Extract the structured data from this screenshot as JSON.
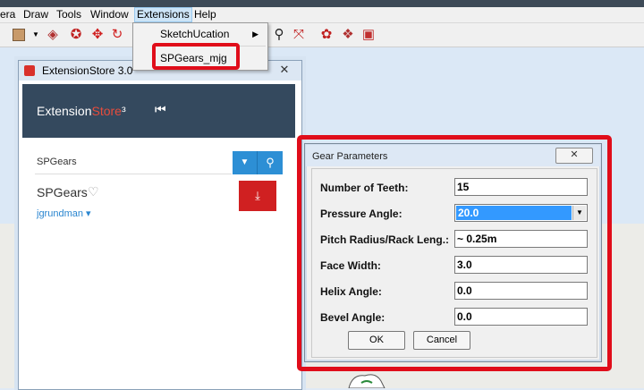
{
  "menubar": {
    "items": [
      "era",
      "Draw",
      "Tools",
      "Window",
      "Extensions",
      "Help"
    ]
  },
  "extensions_menu": {
    "items": [
      {
        "label": "SketchUcation",
        "has_submenu": true
      },
      {
        "label": "SPGears_mjg",
        "has_submenu": false
      }
    ]
  },
  "toolbar": {
    "icons": [
      "box-icon",
      "dropdown-arrow-icon",
      "zoom-extents-icon",
      "follow-me-icon",
      "move-icon",
      "rotate-icon",
      "zoom-icon",
      "zoom-window-icon",
      "plugin-icon-1",
      "plugin-icon-2",
      "plugin-icon-3"
    ]
  },
  "extension_store": {
    "window_title": "ExtensionStore 3.0",
    "brand_part1": "Extension",
    "brand_part2": "Store",
    "brand_suffix": "³",
    "close_symbol": "✕",
    "search_value": "SPGears",
    "result": {
      "name": "SPGears",
      "author": "jgrundman"
    }
  },
  "gear_dialog": {
    "title": "Gear Parameters",
    "close_symbol": "✕",
    "params": [
      {
        "label": "Number of Teeth:",
        "value": "15"
      },
      {
        "label": "Pressure Angle:",
        "value": "20.0",
        "type": "select"
      },
      {
        "label": "Pitch Radius/Rack Leng.:",
        "value": "~ 0.25m"
      },
      {
        "label": "Face Width:",
        "value": "3.0"
      },
      {
        "label": "Helix Angle:",
        "value": "0.0"
      },
      {
        "label": "Bevel Angle:",
        "value": "0.0"
      }
    ],
    "ok_label": "OK",
    "cancel_label": "Cancel"
  },
  "colors": {
    "highlight": "#e00d1a",
    "store_header": "#34495e",
    "store_accent": "#e74c3c",
    "search_button": "#2d8fd5",
    "download_button": "#d02021",
    "select_highlight": "#3399ff"
  }
}
